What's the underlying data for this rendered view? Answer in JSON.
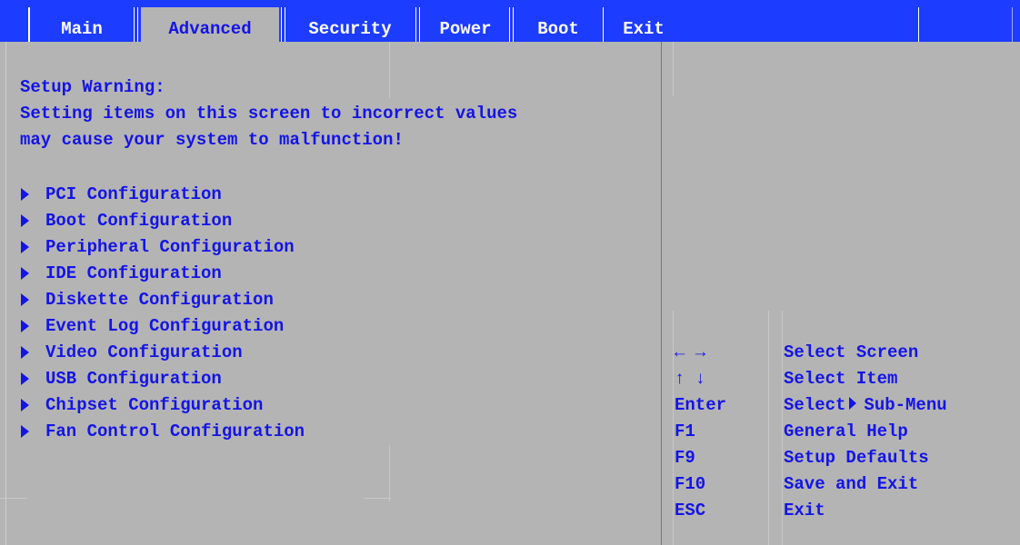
{
  "tabs": [
    {
      "label": "Main"
    },
    {
      "label": "Advanced"
    },
    {
      "label": "Security"
    },
    {
      "label": "Power"
    },
    {
      "label": "Boot"
    },
    {
      "label": "Exit"
    }
  ],
  "active_tab": "Advanced",
  "warning": {
    "title": "Setup Warning:",
    "line1": "Setting items on this screen to incorrect values",
    "line2": "may cause your system to malfunction!"
  },
  "menu_items": [
    {
      "label": "PCI Configuration"
    },
    {
      "label": "Boot Configuration"
    },
    {
      "label": "Peripheral Configuration"
    },
    {
      "label": "IDE Configuration"
    },
    {
      "label": "Diskette Configuration"
    },
    {
      "label": "Event Log Configuration"
    },
    {
      "label": "Video Configuration"
    },
    {
      "label": "USB Configuration"
    },
    {
      "label": "Chipset Configuration"
    },
    {
      "label": "Fan Control Configuration"
    }
  ],
  "help": [
    {
      "key": "← →",
      "desc": "Select Screen"
    },
    {
      "key": "↑ ↓",
      "desc": "Select Item"
    },
    {
      "key": "Enter",
      "desc_prefix": "Select",
      "desc_suffix": "Sub-Menu"
    },
    {
      "key": "F1",
      "desc": "General Help"
    },
    {
      "key": "F9",
      "desc": "Setup Defaults"
    },
    {
      "key": "F10",
      "desc": "Save and Exit"
    },
    {
      "key": "ESC",
      "desc": "Exit"
    }
  ],
  "colors": {
    "menubar": "#1c3cff",
    "background": "#b4b4b4",
    "text": "#1414e6",
    "menubar_text": "#ffffff"
  }
}
